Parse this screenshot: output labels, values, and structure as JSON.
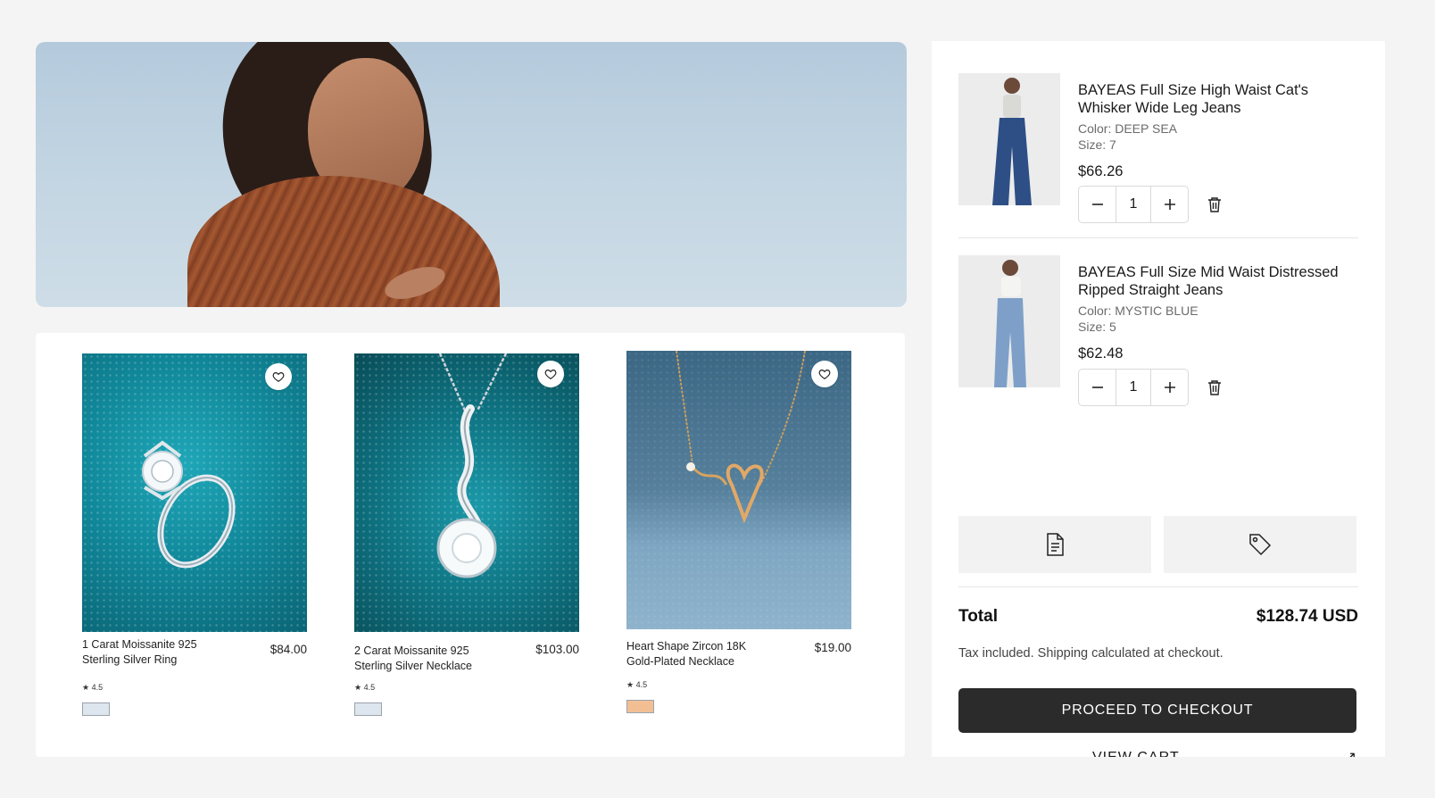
{
  "products": [
    {
      "name": "1 Carat Moissanite 925 Sterling Silver Ring",
      "price": "$84.00",
      "rating": "★ 4.5",
      "swatch_color": "#dde6ee"
    },
    {
      "name": "2 Carat Moissanite 925 Sterling Silver Necklace",
      "price": "$103.00",
      "rating": "★ 4.5",
      "swatch_color": "#dde6ee"
    },
    {
      "name": "Heart Shape Zircon 18K Gold-Plated Necklace",
      "price": "$19.00",
      "rating": "★ 4.5",
      "swatch_color": "#f2bf95"
    }
  ],
  "cart": {
    "items": [
      {
        "title": "BAYEAS Full Size High Waist Cat's Whisker Wide Leg Jeans",
        "color": "Color: DEEP SEA",
        "size": "Size: 7",
        "price": "$66.26",
        "qty": "1"
      },
      {
        "title": "BAYEAS Full Size Mid Waist Distressed Ripped Straight Jeans",
        "color": "Color: MYSTIC BLUE",
        "size": "Size: 5",
        "price": "$62.48",
        "qty": "1"
      }
    ],
    "total_label": "Total",
    "total_value": "$128.74 USD",
    "tax_note": "Tax included. Shipping calculated at checkout.",
    "checkout_label": "PROCEED TO CHECKOUT",
    "view_cart_label": "VIEW CART",
    "view_cart_arrow": "↗"
  },
  "icons": {
    "heart": "heart-icon",
    "minus": "minus-icon",
    "plus": "plus-icon",
    "trash": "trash-icon",
    "note": "note-icon",
    "tag": "tag-icon"
  }
}
